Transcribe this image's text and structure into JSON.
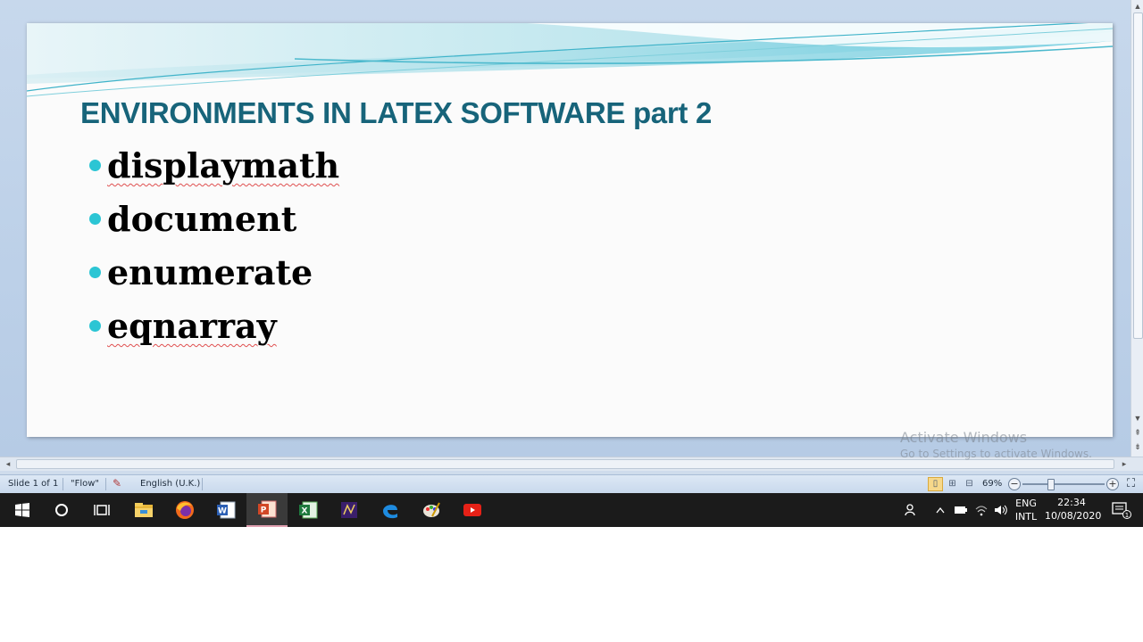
{
  "slide": {
    "title": "ENVIRONMENTS IN LATEX SOFTWARE part 2",
    "bullets": [
      {
        "text": "displaymath",
        "spellcheck": true
      },
      {
        "text": "document",
        "spellcheck": false
      },
      {
        "text": "enumerate",
        "spellcheck": false
      },
      {
        "text": "eqnarray",
        "spellcheck": true
      }
    ],
    "title_color": "#17647a",
    "bullet_color": "#2bc5d4"
  },
  "watermark": {
    "title": "Activate Windows",
    "subtitle": "Go to Settings to activate Windows."
  },
  "statusbar": {
    "slide_info": "Slide 1 of 1",
    "theme": "\"Flow\"",
    "language": "English (U.K.)",
    "zoom": "69%"
  },
  "taskbar": {
    "apps": [
      "start-icon",
      "search-icon",
      "task-view-icon",
      "file-explorer-icon",
      "firefox-icon",
      "word-icon",
      "powerpoint-icon",
      "excel-icon",
      "texworks-icon",
      "edge-icon",
      "paint-icon",
      "youtube-icon"
    ],
    "active_app": "powerpoint-icon",
    "lang_top": "ENG",
    "lang_bottom": "INTL",
    "time": "22:34",
    "date": "10/08/2020",
    "notifications": "1"
  }
}
